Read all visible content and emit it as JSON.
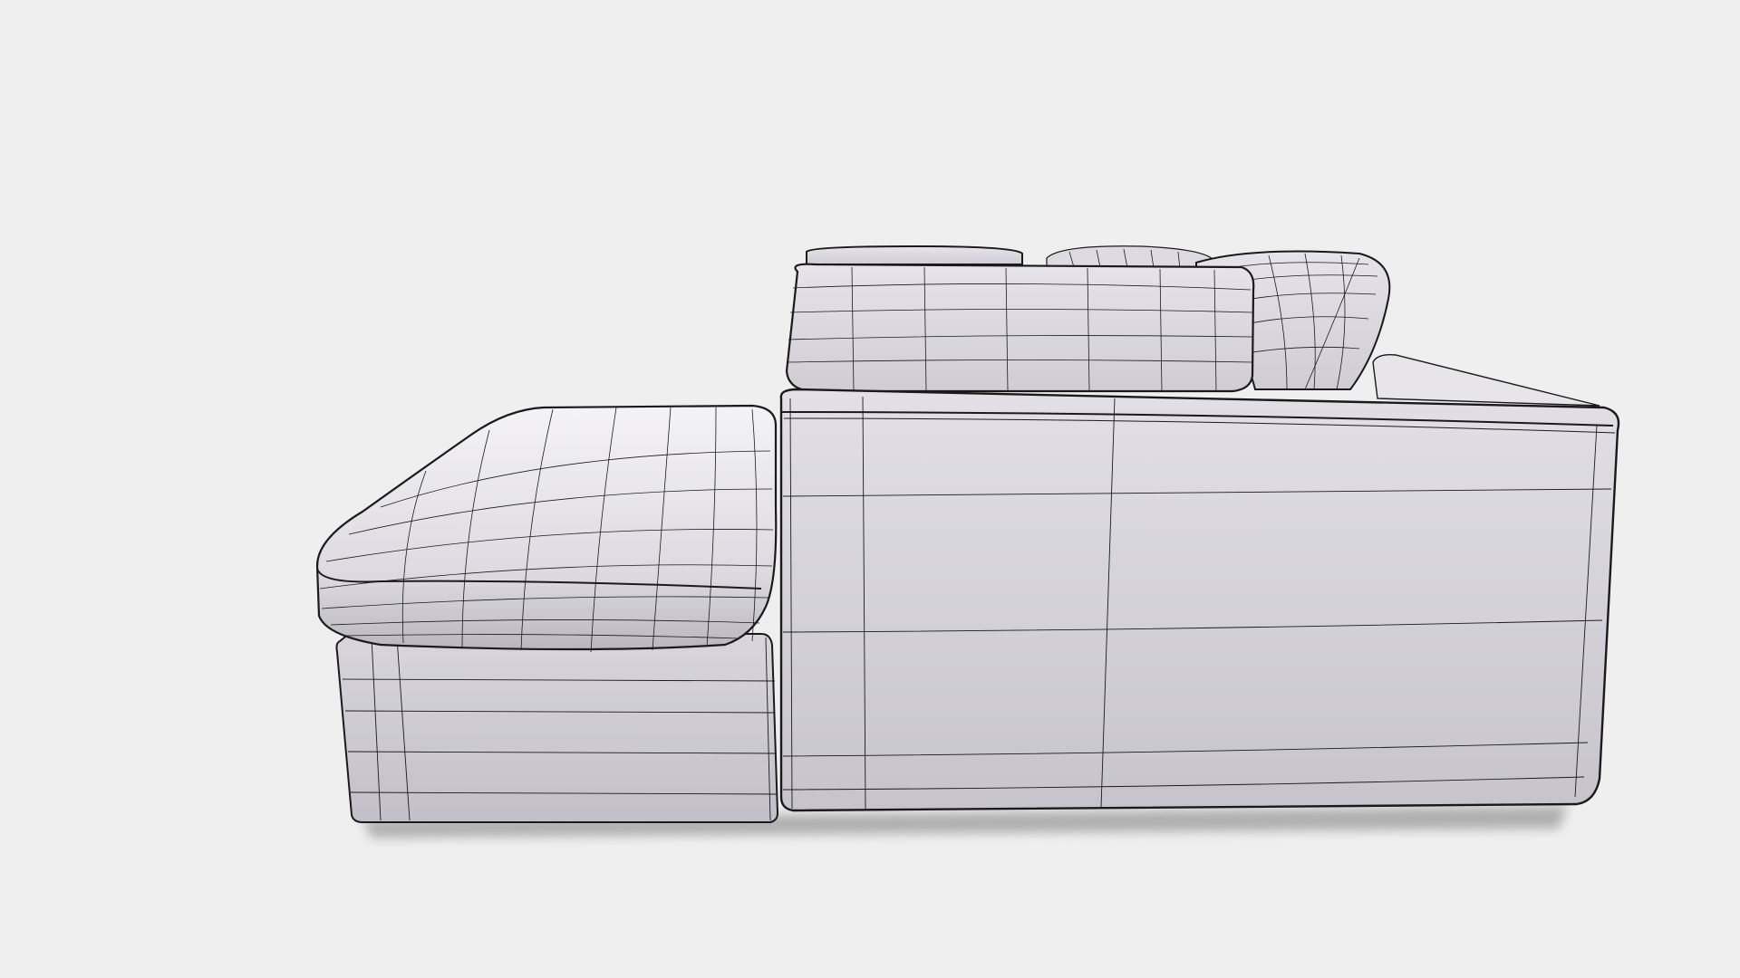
{
  "scene": {
    "subject": "sofa-wireframe-render",
    "background_color": "#efefef",
    "surface_color": "#d2cfd6",
    "wire_color": "#1a1a1a"
  }
}
